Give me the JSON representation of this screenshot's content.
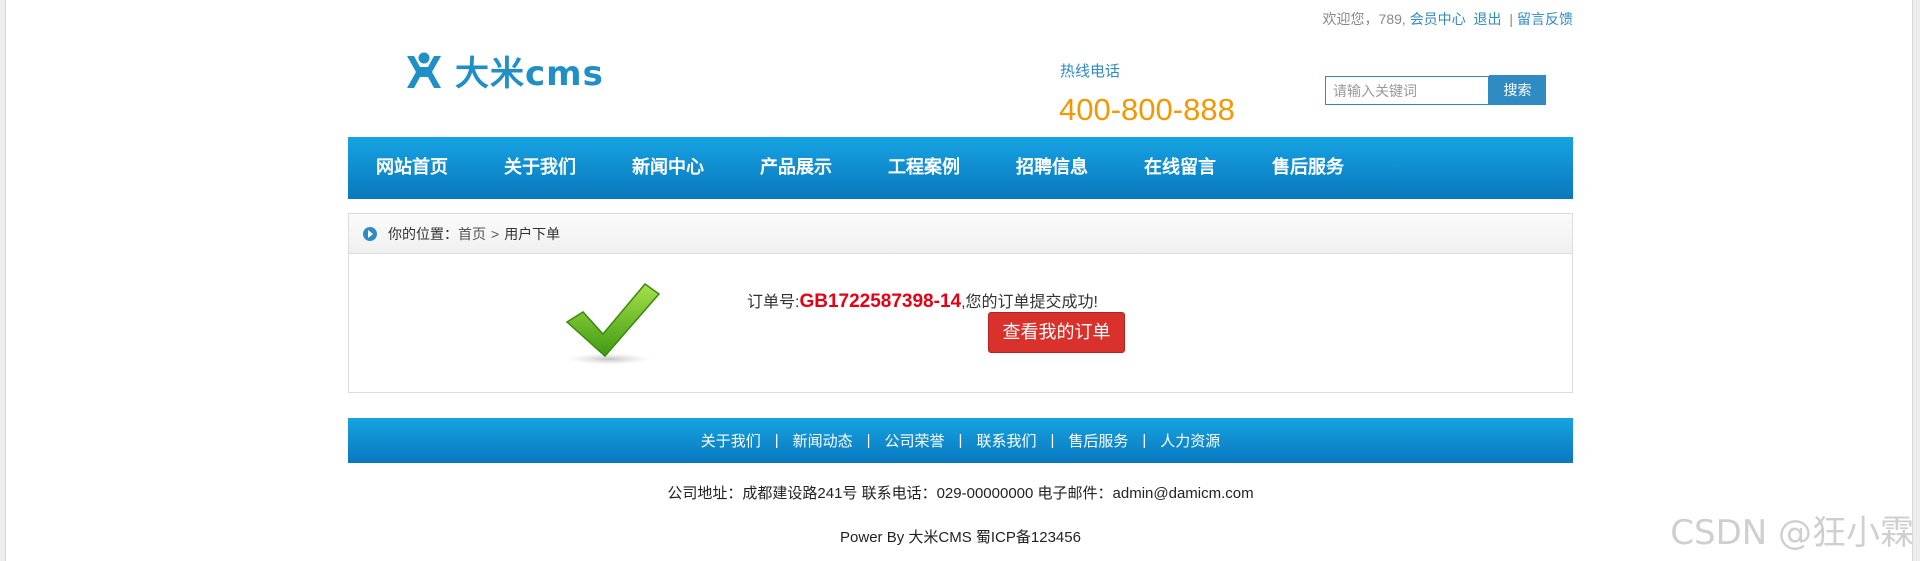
{
  "topbar": {
    "welcome": "欢迎您，789,",
    "member_center": "会员中心",
    "logout": "退出",
    "divider": "|",
    "feedback": "留言反馈"
  },
  "logo": {
    "text": "大米cms",
    "icon": "person-icon",
    "color": "#1f8fc6"
  },
  "hotline": {
    "label": "热线电话",
    "number": "400-800-888",
    "number_color": "#f39800"
  },
  "search": {
    "placeholder": "请输入关键词",
    "button": "搜索"
  },
  "nav": {
    "items": [
      "网站首页",
      "关于我们",
      "新闻中心",
      "产品展示",
      "工程案例",
      "招聘信息",
      "在线留言",
      "售后服务"
    ],
    "background": "#0d8bd0"
  },
  "breadcrumb": {
    "label": "你的位置：",
    "home": "首页",
    "arrow": ">",
    "current": "用户下单"
  },
  "order": {
    "prefix": "订单号:",
    "number": "GB1722587398-14",
    "suffix": ",您的订单提交成功!",
    "view_button": "查看我的订单",
    "success_icon": "check-mark-icon"
  },
  "footer": {
    "links": [
      "关于我们",
      "新闻动态",
      "公司荣誉",
      "联系我们",
      "售后服务",
      "人力资源"
    ],
    "separator": "|",
    "info": "公司地址：成都建设路241号 联系电话：029-00000000 电子邮件：admin@damicm.com",
    "power": "Power By 大米CMS  蜀ICP备123456"
  },
  "watermark": "CSDN @狂小霖"
}
